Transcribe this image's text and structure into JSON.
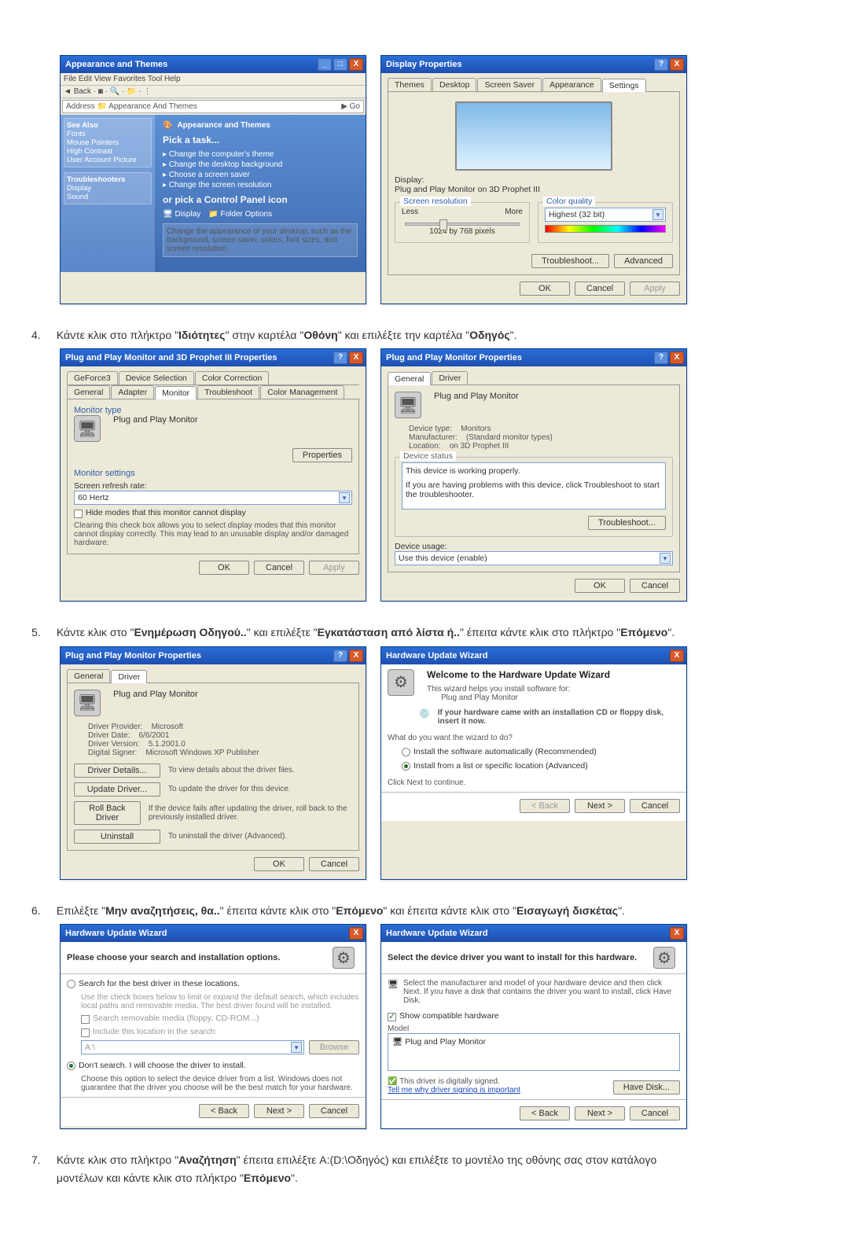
{
  "step4": {
    "num": "4.",
    "text_a": "Κάντε κλικ στο πλήκτρο \"",
    "properties_word": "Ιδιότητες",
    "text_b": "\" στην καρτέλα \"",
    "screen_word": "Οθόνη",
    "text_c": "\" και επιλέξτε την καρτέλα \"",
    "driver_word": "Οδηγός",
    "text_d": "\"."
  },
  "step5": {
    "num": "5.",
    "text_a": "Κάντε κλικ στο \"",
    "update_driver": "Ενημέρωση Οδηγού..",
    "text_b": "\" και επιλέξτε \"",
    "install_from_list": "Εγκατάσταση από λίστα ή..",
    "text_c": "\" έπειτα κάντε κλικ στο πλήκτρο \"",
    "next_word": "Επόμενο",
    "text_d": "\"."
  },
  "step6": {
    "num": "6.",
    "text_a": "Επιλέξτε \"",
    "dont_search": "Μην αναζητήσεις, θα..",
    "text_b": "\" έπειτα κάντε κλικ στο \"",
    "next_word": "Επόμενο",
    "text_c": "\" και έπειτα κάντε κλικ στο \"",
    "have_disk": "Εισαγωγή δισκέτας",
    "text_d": "\"."
  },
  "step7": {
    "num": "7.",
    "text_a": "Κάντε κλικ στο πλήκτρο \"",
    "browse_word": "Αναζήτηση",
    "text_b": "\" έπειτα επιλέξτε A:(D:\\Οδηγός) και επιλέξτε το μοντέλο της οθόνης σας στον κατάλογο μοντέλων και κάντε κλικ στο πλήκτρο \"",
    "next_word": "Επόμενο",
    "text_d": "\"."
  },
  "explorer": {
    "title": "Appearance and Themes",
    "menu": "File  Edit  View  Favorites  Tool  Help",
    "back": "Back",
    "address_label": "Address",
    "address_value": "Appearance And Themes",
    "go": "Go",
    "side": {
      "see_also": "See Also",
      "item1": "Fonts",
      "item2": "Mouse Pointers",
      "item3": "High Contrast",
      "item4": "User Account Picture",
      "troubleshooters": "Troubleshooters",
      "t1": "Display",
      "t2": "Sound"
    },
    "main": {
      "heading": "Appearance and Themes",
      "pick": "Pick a task...",
      "task1": "Change the computer's theme",
      "task2": "Change the desktop background",
      "task3": "Choose a screen saver",
      "task4": "Change the screen resolution",
      "or_pick": "or pick a Control Panel icon",
      "icon1": "Display",
      "icon2": "Folder Options",
      "icon_desc": "Change the appearance of your desktop, such as the background, screen saver, colors, font sizes, and screen resolution."
    }
  },
  "dispprop": {
    "title": "Display Properties",
    "tabs": {
      "themes": "Themes",
      "desktop": "Desktop",
      "screensaver": "Screen Saver",
      "appearance": "Appearance",
      "settings": "Settings"
    },
    "display_label": "Display:",
    "display_value": "Plug and Play Monitor on 3D Prophet III",
    "res_group": "Screen resolution",
    "less": "Less",
    "more": "More",
    "res_value": "1024 by 768 pixels",
    "color_group": "Color quality",
    "color_value": "Highest (32 bit)",
    "troubleshoot_btn": "Troubleshoot...",
    "advanced_btn": "Advanced",
    "ok": "OK",
    "cancel": "Cancel",
    "apply": "Apply"
  },
  "advprop": {
    "title": "Plug and Play Monitor and 3D Prophet III Properties",
    "tabs": {
      "geforce": "GeForce3",
      "device_selection": "Device Selection",
      "color_correction": "Color Correction",
      "general": "General",
      "adapter": "Adapter",
      "monitor": "Monitor",
      "troubleshoot": "Troubleshoot",
      "colormgmt": "Color Management"
    },
    "monitor_type": "Monitor type",
    "monitor_name": "Plug and Play Monitor",
    "properties_btn": "Properties",
    "monitor_settings": "Monitor settings",
    "refresh_label": "Screen refresh rate:",
    "refresh_value": "60 Hertz",
    "hide_modes": "Hide modes that this monitor cannot display",
    "hide_modes_desc": "Clearing this check box allows you to select display modes that this monitor cannot display correctly. This may lead to an unusable display and/or damaged hardware.",
    "ok": "OK",
    "cancel": "Cancel",
    "apply": "Apply"
  },
  "monprop": {
    "title": "Plug and Play Monitor Properties",
    "tabs": {
      "general": "General",
      "driver": "Driver"
    },
    "dev_name": "Plug and Play Monitor",
    "devtype_lbl": "Device type:",
    "devtype_val": "Monitors",
    "mfg_lbl": "Manufacturer:",
    "mfg_val": "(Standard monitor types)",
    "loc_lbl": "Location:",
    "loc_val": "on 3D Prophet III",
    "status_group": "Device status",
    "status_line1": "This device is working properly.",
    "status_line2": "If you are having problems with this device, click Troubleshoot to start the troubleshooter.",
    "troubleshoot_btn": "Troubleshoot...",
    "usage_lbl": "Device usage:",
    "usage_val": "Use this device (enable)",
    "ok": "OK",
    "cancel": "Cancel"
  },
  "monprop_driver": {
    "title": "Plug and Play Monitor Properties",
    "tabs": {
      "general": "General",
      "driver": "Driver"
    },
    "dev_name": "Plug and Play Monitor",
    "prov_lbl": "Driver Provider:",
    "prov_val": "Microsoft",
    "date_lbl": "Driver Date:",
    "date_val": "6/6/2001",
    "ver_lbl": "Driver Version:",
    "ver_val": "5.1.2001.0",
    "sign_lbl": "Digital Signer:",
    "sign_val": "Microsoft Windows XP Publisher",
    "btn_details": "Driver Details...",
    "btn_details_desc": "To view details about the driver files.",
    "btn_update": "Update Driver...",
    "btn_update_desc": "To update the driver for this device.",
    "btn_roll": "Roll Back Driver",
    "btn_roll_desc": "If the device fails after updating the driver, roll back to the previously installed driver.",
    "btn_uninstall": "Uninstall",
    "btn_uninstall_desc": "To uninstall the driver (Advanced).",
    "ok": "OK",
    "cancel": "Cancel"
  },
  "wiz1": {
    "title": "Hardware Update Wizard",
    "welcome": "Welcome to the Hardware Update Wizard",
    "intro": "This wizard helps you install software for:",
    "device": "Plug and Play Monitor",
    "cd_note": "If your hardware came with an installation CD or floppy disk, insert it now.",
    "what": "What do you want the wizard to do?",
    "opt_auto": "Install the software automatically (Recommended)",
    "opt_list": "Install from a list or specific location (Advanced)",
    "click_next": "Click Next to continue.",
    "back": "< Back",
    "next": "Next >",
    "cancel": "Cancel"
  },
  "wiz2": {
    "title": "Hardware Update Wizard",
    "heading": "Please choose your search and installation options.",
    "opt_search": "Search for the best driver in these locations.",
    "opt_search_desc": "Use the check boxes below to limit or expand the default search, which includes local paths and removable media. The best driver found will be installed.",
    "chk_media": "Search removable media (floppy, CD-ROM...)",
    "chk_include": "Include this location in the search:",
    "path": "A:\\",
    "browse_btn": "Browse",
    "opt_dont": "Don't search. I will choose the driver to install.",
    "opt_dont_desc": "Choose this option to select the device driver from a list. Windows does not guarantee that the driver you choose will be the best match for your hardware.",
    "back": "< Back",
    "next": "Next >",
    "cancel": "Cancel"
  },
  "wiz3": {
    "title": "Hardware Update Wizard",
    "heading": "Select the device driver you want to install for this hardware.",
    "instr": "Select the manufacturer and model of your hardware device and then click Next. If you have a disk that contains the driver you want to install, click Have Disk.",
    "show_compat": "Show compatible hardware",
    "model_lbl": "Model",
    "model_val": "Plug and Play Monitor",
    "signed": "This driver is digitally signed.",
    "tell_why": "Tell me why driver signing is important",
    "have_disk_btn": "Have Disk...",
    "back": "< Back",
    "next": "Next >",
    "cancel": "Cancel"
  },
  "common": {
    "help": "?",
    "close": "X"
  }
}
